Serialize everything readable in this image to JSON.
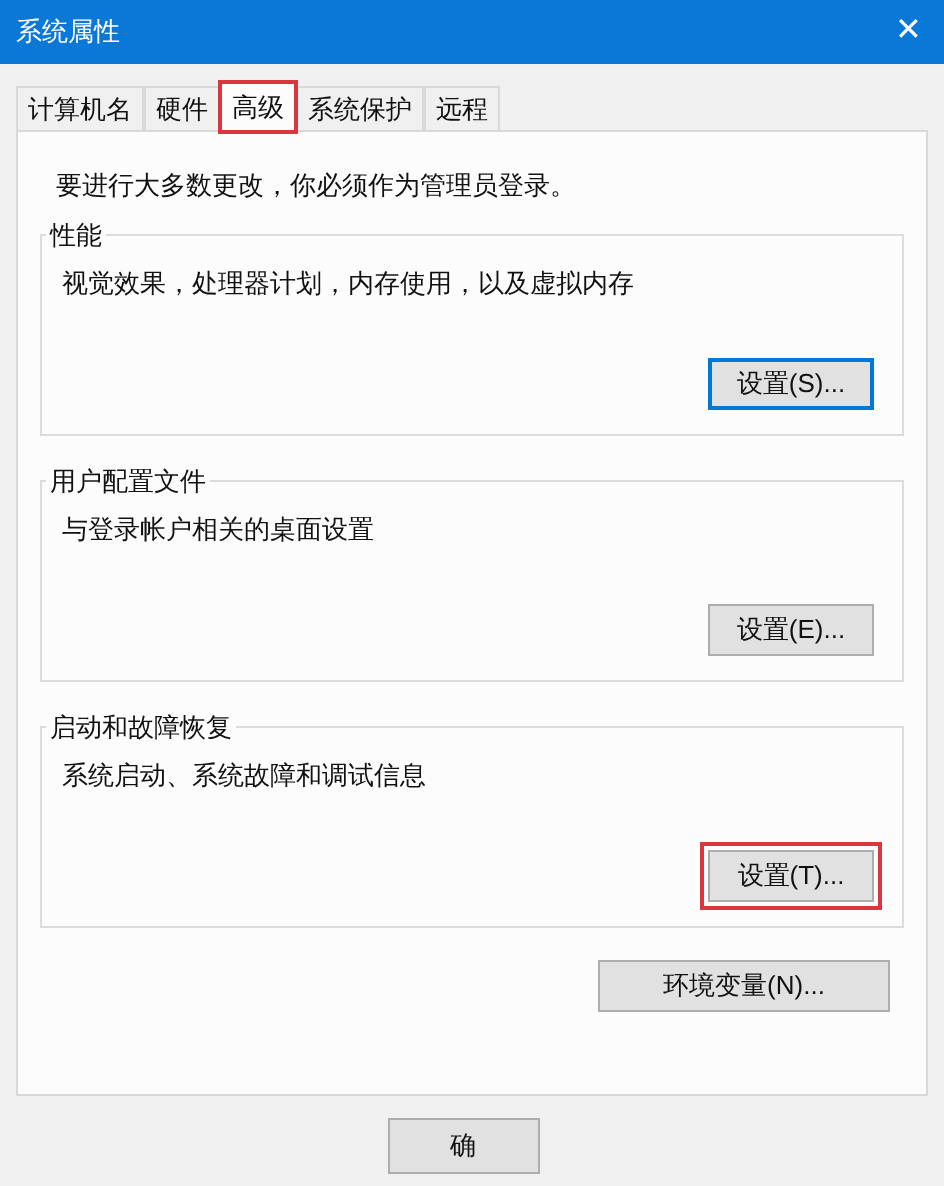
{
  "window": {
    "title": "系统属性",
    "close": "✕"
  },
  "tabs": [
    {
      "label": "计算机名",
      "selected": false,
      "highlighted": false
    },
    {
      "label": "硬件",
      "selected": false,
      "highlighted": false
    },
    {
      "label": "高级",
      "selected": true,
      "highlighted": true
    },
    {
      "label": "系统保护",
      "selected": false,
      "highlighted": false
    },
    {
      "label": "远程",
      "selected": false,
      "highlighted": false
    }
  ],
  "notice": "要进行大多数更改，你必须作为管理员登录。",
  "groups": [
    {
      "title": "性能",
      "description": "视觉效果，处理器计划，内存使用，以及虚拟内存",
      "button": {
        "label": "设置(S)...",
        "focused": true,
        "highlighted": false
      }
    },
    {
      "title": "用户配置文件",
      "description": "与登录帐户相关的桌面设置",
      "button": {
        "label": "设置(E)...",
        "focused": false,
        "highlighted": false
      }
    },
    {
      "title": "启动和故障恢复",
      "description": "系统启动、系统故障和调试信息",
      "button": {
        "label": "设置(T)...",
        "focused": false,
        "highlighted": true
      }
    }
  ],
  "env_button": "环境变量(N)...",
  "footer_buttons": [
    "确"
  ]
}
